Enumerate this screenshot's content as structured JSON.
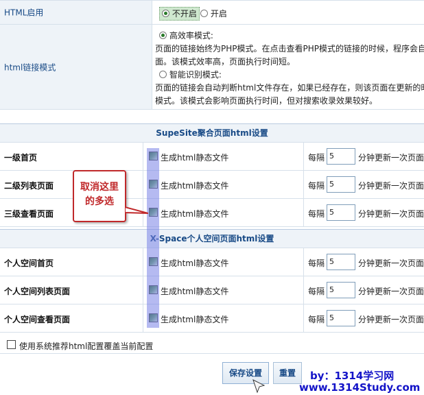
{
  "html_enable": {
    "label": "HTML启用",
    "options": [
      {
        "label": "不开启",
        "selected": true
      },
      {
        "label": "开启",
        "selected": false
      }
    ]
  },
  "link_mode": {
    "label": "html链接模式",
    "options": [
      {
        "label": "高效率模式:",
        "selected": true,
        "desc": [
          "页面的链接始终为PHP模式。在点击查看PHP模式的链接的时候，程序会自",
          "面。该模式效率高，页面执行时间短。"
        ]
      },
      {
        "label": "智能识别模式:",
        "selected": false,
        "desc": [
          "页面的链接会自动判断html文件存在，如果已经存在，则该页面在更新的时",
          "模式。该模式会影响页面执行时间，但对搜索收录效果较好。"
        ]
      }
    ]
  },
  "supesite": {
    "title": "SupeSite聚合页面html设置",
    "rows": [
      {
        "name": "一级首页",
        "gen": "生成html静态文件",
        "interval_prefix": "每隔",
        "value": "5",
        "unit": "分钟更新一次页面"
      },
      {
        "name": "二级列表页面",
        "gen": "生成html静态文件",
        "interval_prefix": "每隔",
        "value": "5",
        "unit": "分钟更新一次页面"
      },
      {
        "name": "三级查看页面",
        "gen": "生成html静态文件",
        "interval_prefix": "每隔",
        "value": "5",
        "unit": "分钟更新一次页面"
      }
    ]
  },
  "xspace": {
    "title": "X-Space个人空间页面html设置",
    "rows": [
      {
        "name": "个人空间首页",
        "gen": "生成html静态文件",
        "interval_prefix": "每隔",
        "value": "5",
        "unit": "分钟更新一次页面"
      },
      {
        "name": "个人空间列表页面",
        "gen": "生成html静态文件",
        "interval_prefix": "每隔",
        "value": "5",
        "unit": "分钟更新一次页面"
      },
      {
        "name": "个人空间查看页面",
        "gen": "生成html静态文件",
        "interval_prefix": "每隔",
        "value": "5",
        "unit": "分钟更新一次页面"
      }
    ]
  },
  "recommend_option": "使用系统推荐html配置覆盖当前配置",
  "buttons": {
    "save": "保存设置",
    "reset": "重置"
  },
  "callout": {
    "line1": "取消这里",
    "line2": "的多选"
  },
  "watermark": {
    "line1": "by：1314学习网",
    "line2": "www.1314Study.com"
  },
  "colors": {
    "label_bg": "#eef3f8",
    "label_text": "#184a86",
    "highlight": "#7882e6",
    "callout_red": "#c0282a",
    "watermark_blue": "#1313c8"
  }
}
